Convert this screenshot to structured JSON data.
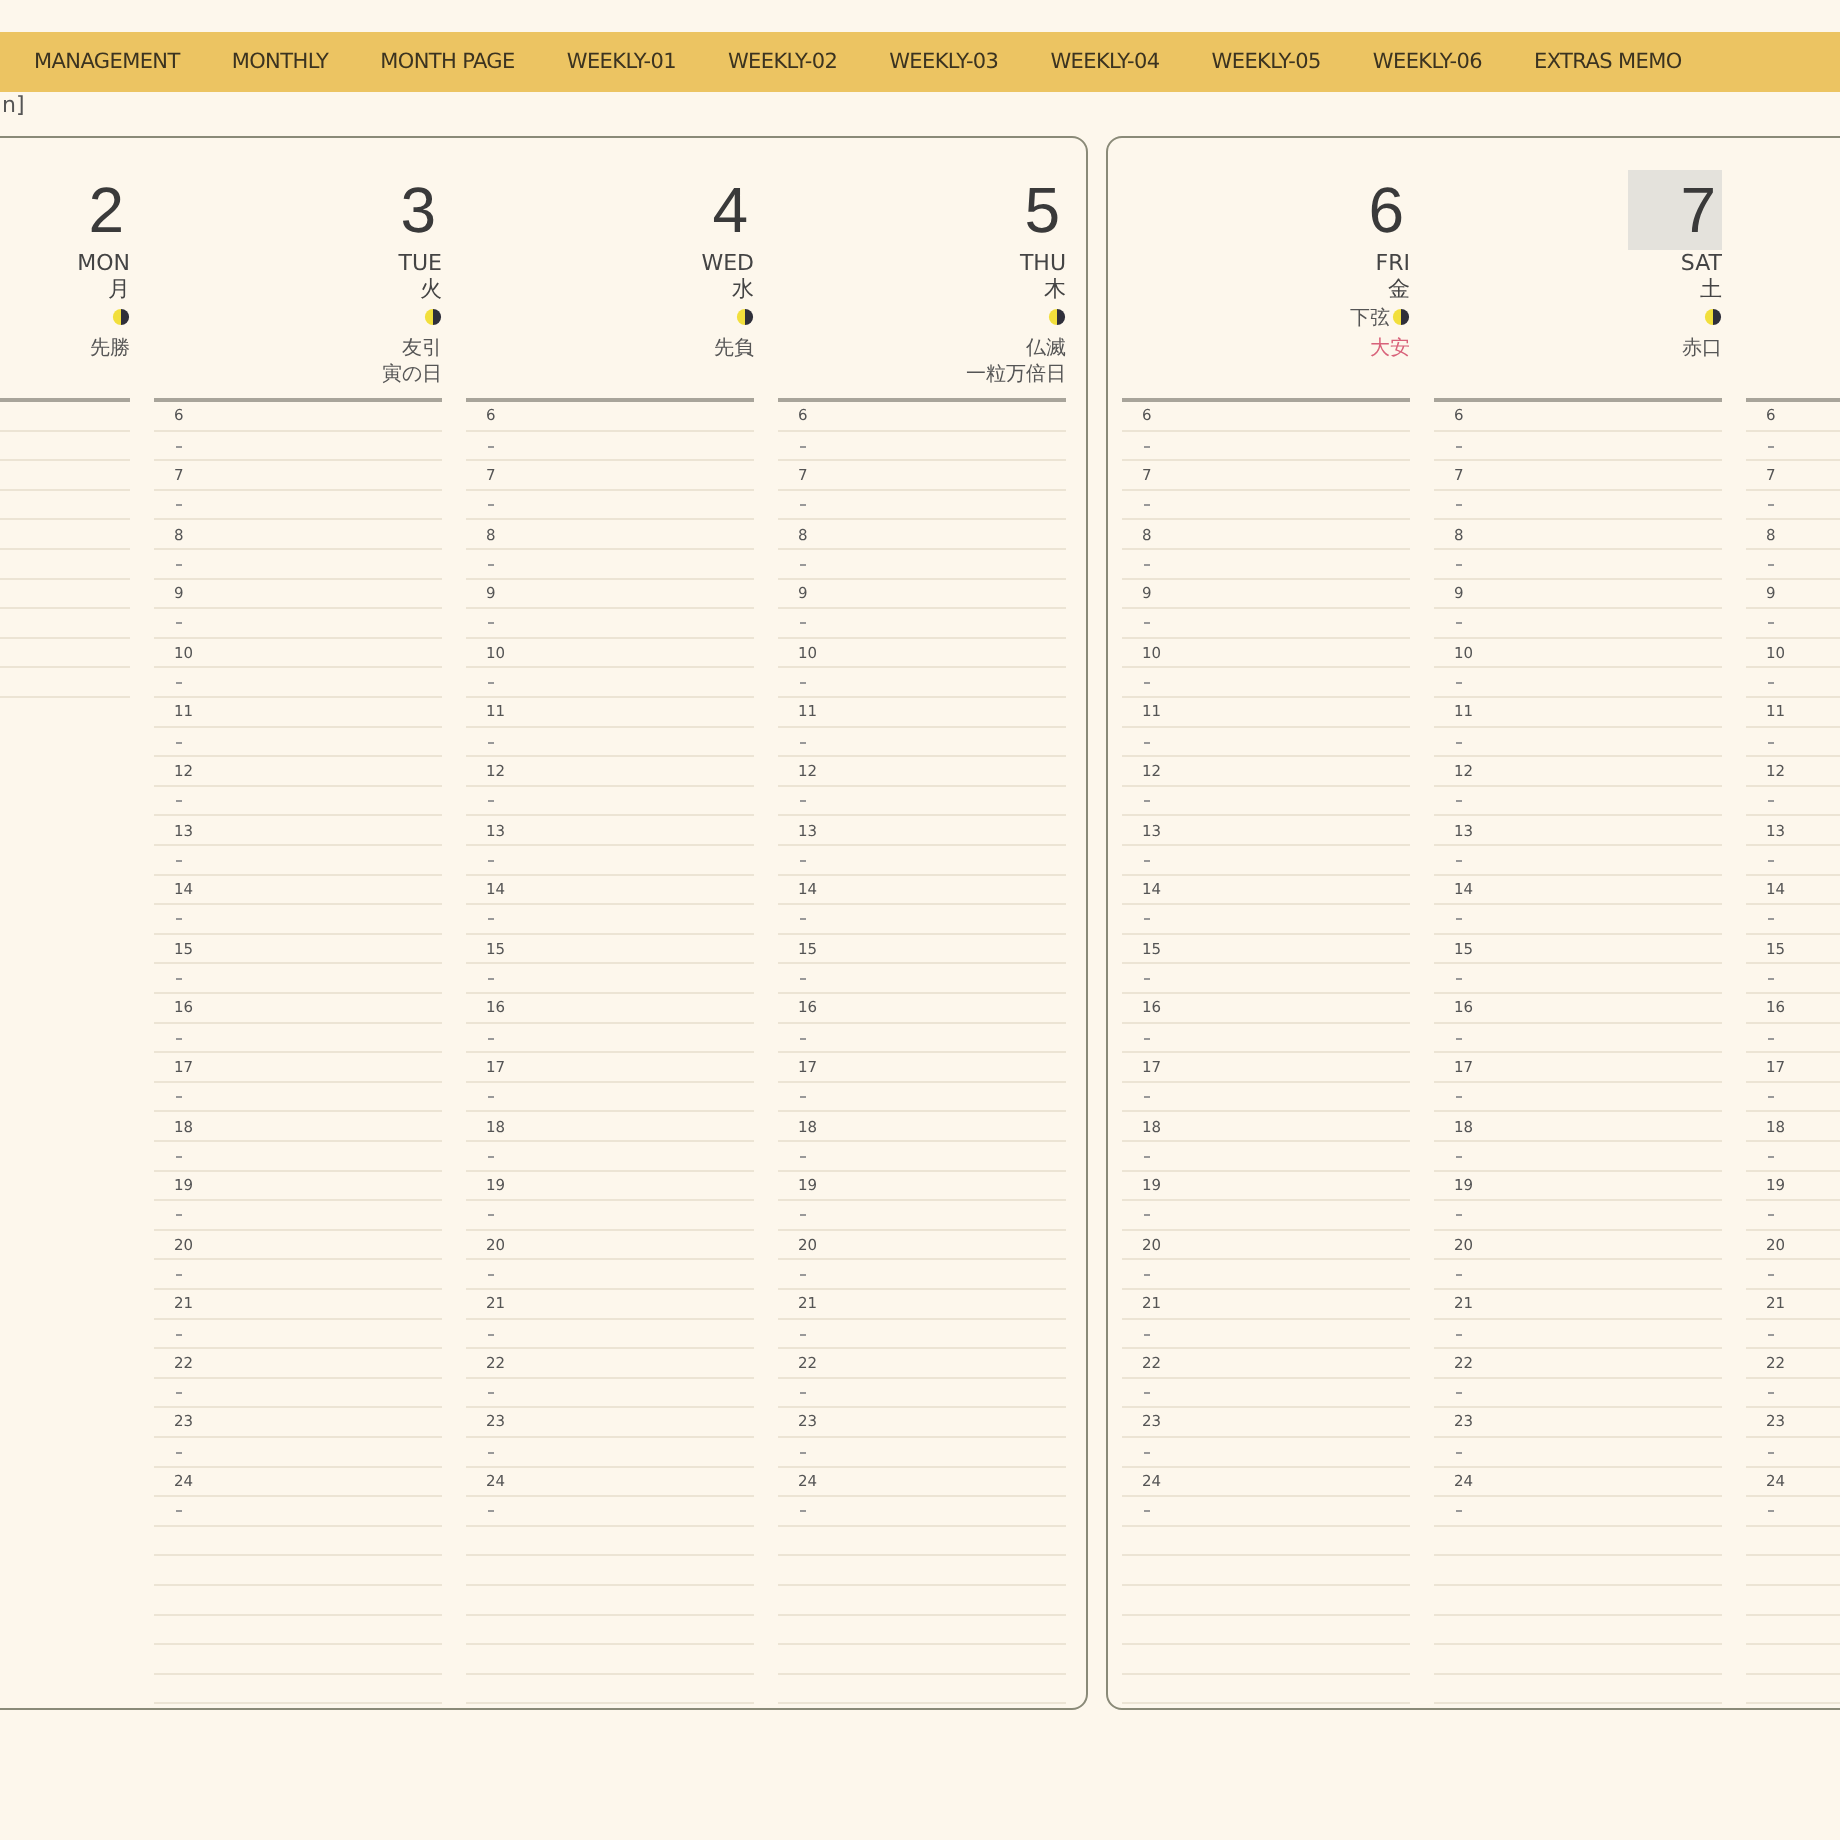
{
  "tabs": [
    {
      "label": "MANAGEMENT"
    },
    {
      "label": "MONTHLY"
    },
    {
      "label": "MONTH PAGE"
    },
    {
      "label": "WEEKLY-01"
    },
    {
      "label": "WEEKLY-02"
    },
    {
      "label": "WEEKLY-03"
    },
    {
      "label": "WEEKLY-04"
    },
    {
      "label": "WEEKLY-05"
    },
    {
      "label": "WEEKLY-06"
    },
    {
      "label": "EXTRAS MEMO"
    }
  ],
  "corner_label": "n]",
  "pages": [
    {
      "days": [
        {
          "date": "2",
          "weekday": "MON",
          "kanji": "月",
          "rokuyo": "先勝",
          "color": "#555555",
          "selected": false
        },
        {
          "date": "3",
          "weekday": "TUE",
          "kanji": "火",
          "rokuyo": "友引",
          "color": "#555555",
          "note": "寅の日",
          "selected": false,
          "hours": [
            "6",
            "7",
            "8",
            "9",
            "10",
            "11",
            "12",
            "13",
            "14",
            "15",
            "16",
            "17",
            "18",
            "19",
            "20",
            "21",
            "22",
            "23",
            "24"
          ]
        },
        {
          "date": "4",
          "weekday": "WED",
          "kanji": "水",
          "rokuyo": "先負",
          "color": "#555555",
          "selected": false,
          "hours": [
            "6",
            "7",
            "8",
            "9",
            "10",
            "11",
            "12",
            "13",
            "14",
            "15",
            "16",
            "17",
            "18",
            "19",
            "20",
            "21",
            "22",
            "23",
            "24"
          ]
        },
        {
          "date": "5",
          "weekday": "THU",
          "kanji": "木",
          "rokuyo": "仏滅",
          "color": "#555555",
          "note": "一粒万倍日",
          "selected": false,
          "hours": [
            "6",
            "7",
            "8",
            "9",
            "10",
            "11",
            "12",
            "13",
            "14",
            "15",
            "16",
            "17",
            "18",
            "19",
            "20",
            "21",
            "22",
            "23",
            "24"
          ]
        }
      ]
    },
    {
      "days": [
        {
          "date": "6",
          "weekday": "FRI",
          "kanji": "金",
          "moon_label": "下弦",
          "rokuyo": "大安",
          "color": "#d8627a",
          "selected": false,
          "hours": [
            "6",
            "7",
            "8",
            "9",
            "10",
            "11",
            "12",
            "13",
            "14",
            "15",
            "16",
            "17",
            "18",
            "19",
            "20",
            "21",
            "22",
            "23",
            "24"
          ]
        },
        {
          "date": "7",
          "weekday": "SAT",
          "kanji": "土",
          "rokuyo": "赤口",
          "color": "#555555",
          "selected": true,
          "hours": [
            "6",
            "7",
            "8",
            "9",
            "10",
            "11",
            "12",
            "13",
            "14",
            "15",
            "16",
            "17",
            "18",
            "19",
            "20",
            "21",
            "22",
            "23",
            "24"
          ]
        },
        {
          "hours": [
            "6",
            "7",
            "8",
            "9",
            "10",
            "11",
            "12",
            "13",
            "14",
            "15",
            "16",
            "17",
            "18",
            "19",
            "20",
            "21",
            "22",
            "23",
            "24"
          ]
        }
      ]
    }
  ]
}
